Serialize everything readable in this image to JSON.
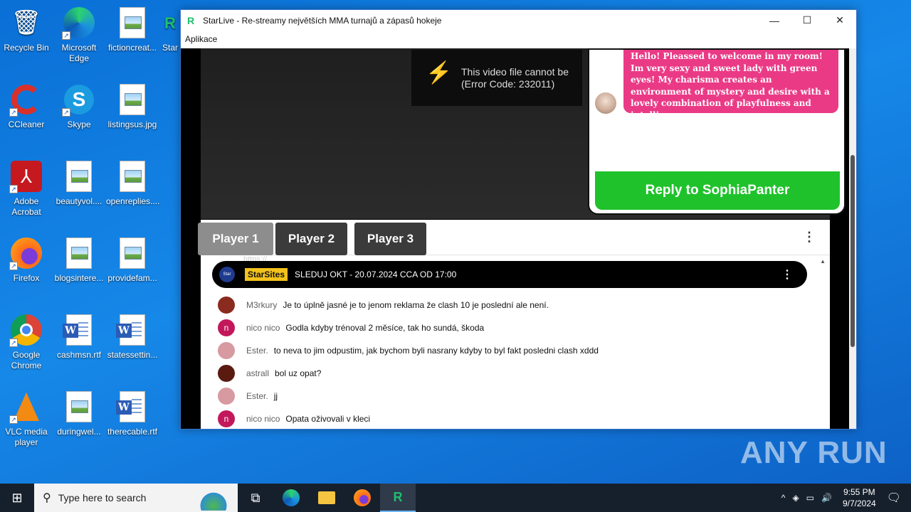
{
  "desktop": {
    "icons": [
      {
        "label": "Recycle Bin",
        "icon": "recycle-bin-icon"
      },
      {
        "label": "Microsoft Edge",
        "icon": "edge-icon"
      },
      {
        "label": "fictioncreat...",
        "icon": "image-file-icon"
      },
      {
        "label": "Star",
        "icon": "app-icon"
      },
      {
        "label": "CCleaner",
        "icon": "ccleaner-icon"
      },
      {
        "label": "Skype",
        "icon": "skype-icon"
      },
      {
        "label": "listingsus.jpg",
        "icon": "image-file-icon"
      },
      {
        "label": "Adobe Acrobat",
        "icon": "acrobat-icon"
      },
      {
        "label": "beautyvol....",
        "icon": "image-file-icon"
      },
      {
        "label": "openreplies....",
        "icon": "image-file-icon"
      },
      {
        "label": "Firefox",
        "icon": "firefox-icon"
      },
      {
        "label": "blogsintere...",
        "icon": "image-file-icon"
      },
      {
        "label": "providefam...",
        "icon": "image-file-icon"
      },
      {
        "label": "Google Chrome",
        "icon": "chrome-icon"
      },
      {
        "label": "cashmsn.rtf",
        "icon": "word-file-icon"
      },
      {
        "label": "statessettin...",
        "icon": "word-file-icon"
      },
      {
        "label": "VLC media player",
        "icon": "vlc-icon"
      },
      {
        "label": "duringwel...",
        "icon": "image-file-icon"
      },
      {
        "label": "therecable.rtf",
        "icon": "word-file-icon"
      }
    ]
  },
  "window": {
    "title": "StarLive - Re-streamy největších MMA turnajů a zápasů hokeje",
    "menu": "Aplikace",
    "controls": {
      "minimize": "—",
      "maximize": "☐",
      "close": "✕"
    }
  },
  "video": {
    "error_line1": "This video file cannot be",
    "error_line2": "(Error Code: 232011)"
  },
  "popup": {
    "message": "Hello! Pleassed to welcome in my room! Im very sexy and sweet lady with green eyes! My charisma creates an environment of mystery and desire with a lovely combination of playfulness and intelligence.",
    "reply_label": "Reply to SophiaPanter"
  },
  "players": {
    "tabs": [
      "Player 1",
      "Player 2",
      "Player 3"
    ],
    "active": 0
  },
  "chat": {
    "faded_url": "https://...",
    "pinned": {
      "badge": "StarSites",
      "text": "SLEDUJ OKT - 20.07.2024 CCA OD 17:00"
    },
    "messages": [
      {
        "name": "M3rkury",
        "text": "Je to úplně jasné je to jenom reklama že clash 10 je poslední ale není.",
        "avatar_color": "#8b2a1f",
        "initial": ""
      },
      {
        "name": "nico nico",
        "text": "Godla kdyby trénoval 2 měsíce, tak ho sundá, škoda",
        "avatar_color": "#c2185b",
        "initial": "n"
      },
      {
        "name": "Ester.",
        "text": "to neva to jim odpustim, jak bychom byli nasrany kdyby to byl fakt posledni clash xddd",
        "avatar_color": "#d79aa0",
        "initial": ""
      },
      {
        "name": "astrall",
        "text": "bol uz opat?",
        "avatar_color": "#5a1a10",
        "initial": ""
      },
      {
        "name": "Ester.",
        "text": "jj",
        "avatar_color": "#d79aa0",
        "initial": ""
      },
      {
        "name": "nico nico",
        "text": "Opata oživovali v kleci",
        "avatar_color": "#c2185b",
        "initial": "n"
      }
    ]
  },
  "taskbar": {
    "search_placeholder": "Type here to search",
    "time": "9:55 PM",
    "date": "9/7/2024"
  },
  "watermark": "ANY RUN"
}
